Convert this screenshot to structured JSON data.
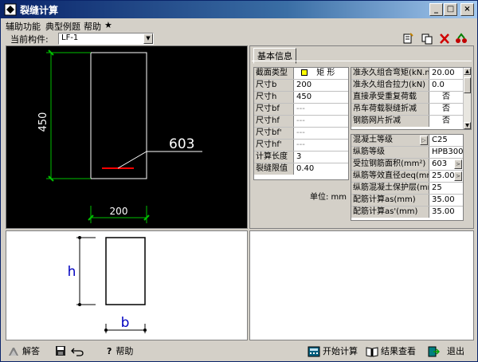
{
  "window": {
    "title": "裂缝计算",
    "minimize": "_",
    "maximize": "□",
    "close": "×"
  },
  "menu": [
    "辅助功能",
    "典型例题",
    "帮助",
    "★"
  ],
  "toolbar": {
    "current_label": "当前构件:",
    "current_value": "LF-1"
  },
  "drawing": {
    "height_dim": "450",
    "width_dim": "200",
    "rebar_label": "603"
  },
  "schematic": {
    "h": "h",
    "b": "b"
  },
  "tab": "基本信息",
  "section_rows": [
    {
      "label": "截面类型",
      "value": "矩  形"
    },
    {
      "label": "尺寸b",
      "value": "200"
    },
    {
      "label": "尺寸h",
      "value": "450"
    },
    {
      "label": "尺寸bf",
      "value": "---"
    },
    {
      "label": "尺寸hf",
      "value": "---"
    },
    {
      "label": "尺寸bf'",
      "value": "---"
    },
    {
      "label": "尺寸hf'",
      "value": "---"
    },
    {
      "label": "计算长度",
      "value": "3"
    },
    {
      "label": "裂缝限值",
      "value": "0.40"
    }
  ],
  "load_rows": [
    {
      "label": "准永久组合弯矩(kN.m)",
      "value": "20.00"
    },
    {
      "label": "准永久组合拉力(kN)",
      "value": "0.0"
    },
    {
      "label": "直接承受重复荷载",
      "value": "否"
    },
    {
      "label": "吊车荷载裂缝折减",
      "value": "否"
    },
    {
      "label": "钢筋网片折减",
      "value": "否"
    }
  ],
  "material_rows": [
    {
      "label": "混凝土等级",
      "value": "C25"
    },
    {
      "label": "纵筋等级",
      "value": "HPB300"
    },
    {
      "label": "受拉钢筋面积(mm²)",
      "value": "603"
    },
    {
      "label": "纵筋等效直径deq(mm)",
      "value": "25.00"
    },
    {
      "label": "纵筋混凝土保护层(mm)",
      "value": "25"
    },
    {
      "label": "配筋计算as(mm)",
      "value": "35.00"
    },
    {
      "label": "配筋计算as'(mm)",
      "value": "35.00"
    }
  ],
  "unit_text": "单位: mm",
  "status": {
    "answer": "解答",
    "help": "帮助",
    "start": "开始计算",
    "view": "结果查看",
    "exit": "退出"
  },
  "colors": {
    "accent_green": "#00c000",
    "rebar_red": "#ff0000",
    "blue_label": "#0000c0"
  }
}
